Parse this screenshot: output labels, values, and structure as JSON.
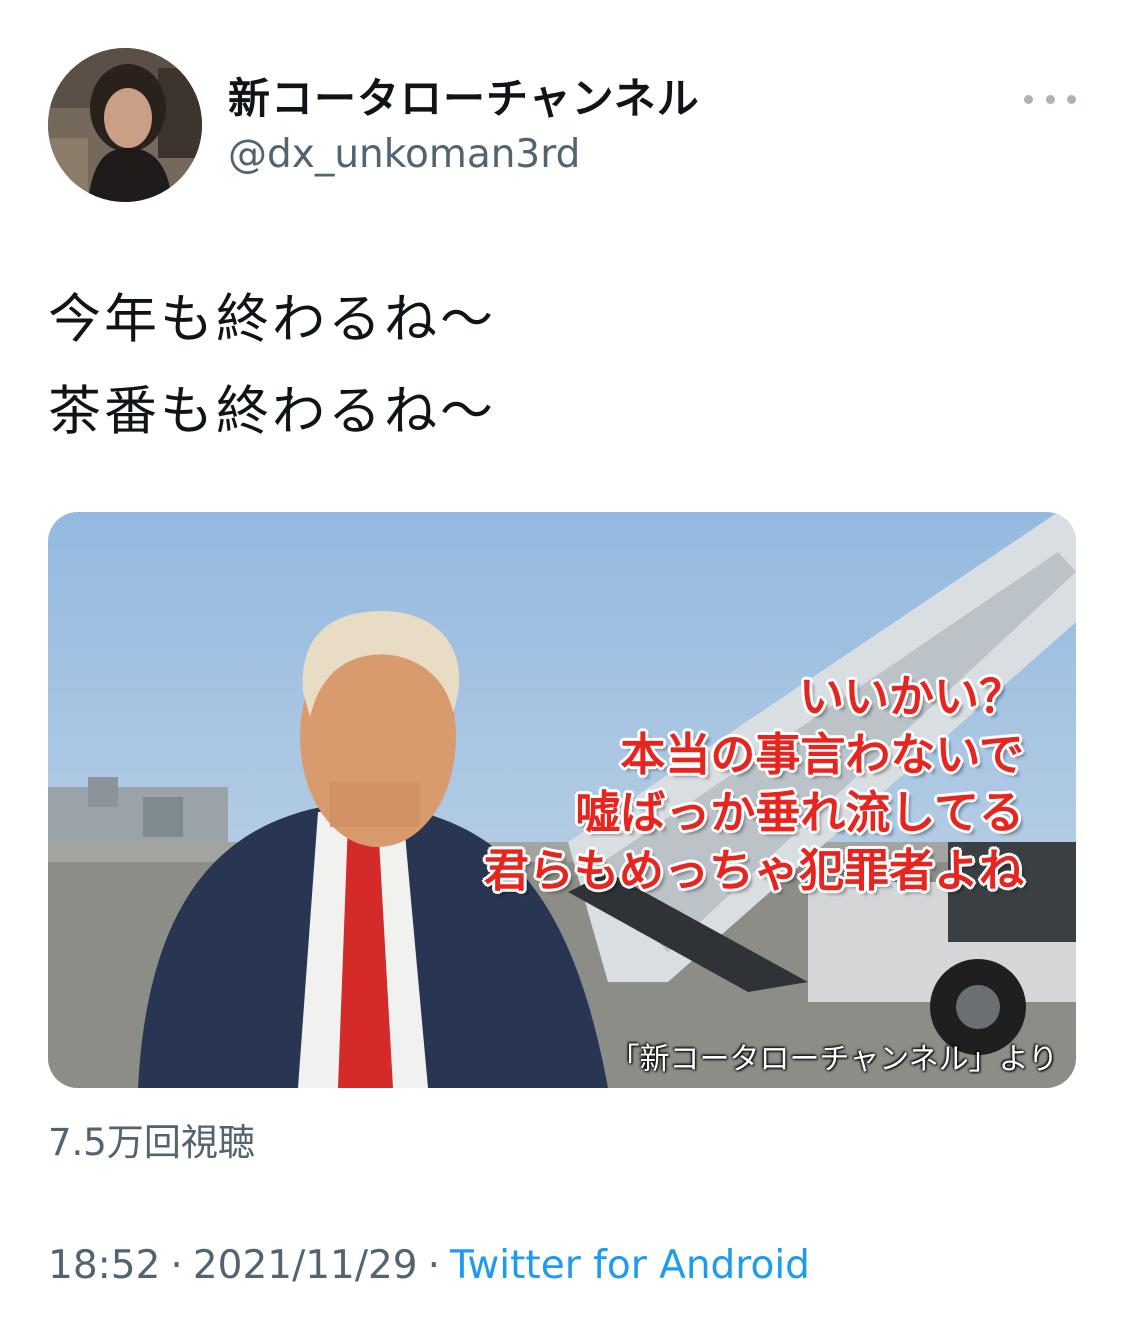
{
  "author": {
    "display_name": "新コータローチャンネル",
    "handle": "@dx_unkoman3rd"
  },
  "tweet": {
    "lines": [
      "今年も終わるね〜",
      "茶番も終わるね〜"
    ]
  },
  "media": {
    "subtitles": [
      "いいかい？",
      "本当の事言わないで",
      "嘘ばっか垂れ流してる",
      "君らもめっちゃ犯罪者よね"
    ],
    "credit": "「新コータローチャンネル」より"
  },
  "stats": {
    "views": "7.5万回視聴"
  },
  "meta": {
    "time": "18:52",
    "separator": "·",
    "date": "2021/11/29",
    "source": "Twitter for Android"
  },
  "icons": {
    "more": "more-horizontal-icon"
  },
  "colors": {
    "link": "#1d9bf0",
    "secondary_text": "#536471",
    "subtitle_red": "#e8241f"
  }
}
